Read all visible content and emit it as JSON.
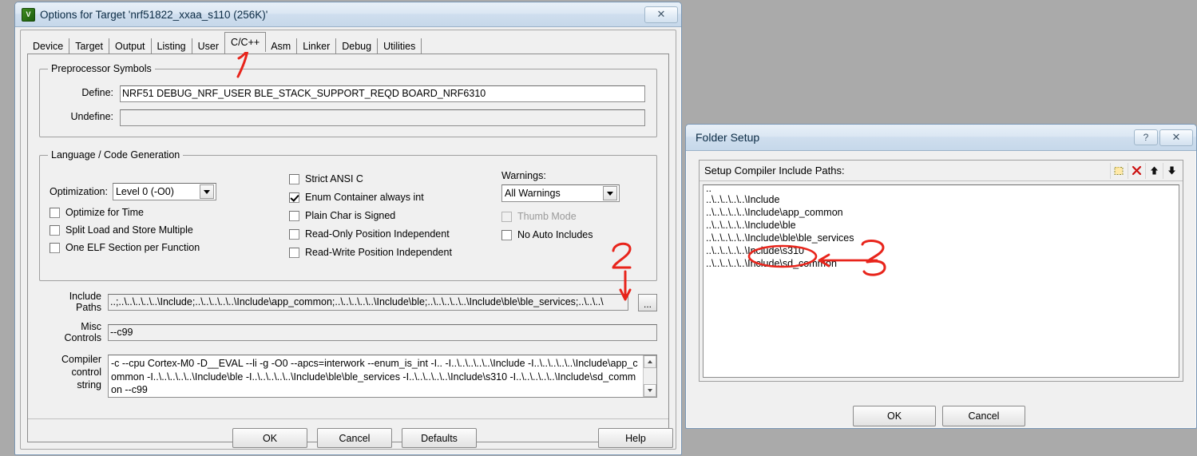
{
  "options_dialog": {
    "title": "Options for Target 'nrf51822_xxaa_s110 (256K)'",
    "icon": "keil-uvision-icon",
    "close_label": "✕",
    "tabs": [
      {
        "label": "Device",
        "active": false
      },
      {
        "label": "Target",
        "active": false
      },
      {
        "label": "Output",
        "active": false
      },
      {
        "label": "Listing",
        "active": false
      },
      {
        "label": "User",
        "active": false
      },
      {
        "label": "C/C++",
        "active": true
      },
      {
        "label": "Asm",
        "active": false
      },
      {
        "label": "Linker",
        "active": false
      },
      {
        "label": "Debug",
        "active": false
      },
      {
        "label": "Utilities",
        "active": false
      }
    ],
    "preprocessor": {
      "group_title": "Preprocessor Symbols",
      "define_label": "Define:",
      "define_value": "NRF51 DEBUG_NRF_USER BLE_STACK_SUPPORT_REQD BOARD_NRF6310",
      "undefine_label": "Undefine:",
      "undefine_value": ""
    },
    "language": {
      "group_title": "Language / Code Generation",
      "optimization_label": "Optimization:",
      "optimization_value": "Level 0 (-O0)",
      "warnings_label": "Warnings:",
      "warnings_value": "All Warnings",
      "left_options": [
        {
          "label": "Optimize for Time",
          "checked": false,
          "disabled": false
        },
        {
          "label": "Split Load and Store Multiple",
          "checked": false,
          "disabled": false
        },
        {
          "label": "One ELF Section per Function",
          "checked": false,
          "disabled": false
        }
      ],
      "middle_options": [
        {
          "label": "Strict ANSI C",
          "checked": false,
          "disabled": false
        },
        {
          "label": "Enum Container always int",
          "checked": true,
          "disabled": false
        },
        {
          "label": "Plain Char is Signed",
          "checked": false,
          "disabled": false
        },
        {
          "label": "Read-Only Position Independent",
          "checked": false,
          "disabled": false
        },
        {
          "label": "Read-Write Position Independent",
          "checked": false,
          "disabled": false
        }
      ],
      "right_options": [
        {
          "label": "Thumb Mode",
          "checked": false,
          "disabled": true
        },
        {
          "label": "No Auto Includes",
          "checked": false,
          "disabled": false
        }
      ]
    },
    "fields": {
      "include_paths_label_1": "Include",
      "include_paths_label_2": "Paths",
      "include_paths_value": "..;..\\..\\..\\..\\..\\Include;..\\..\\..\\..\\..\\Include\\app_common;..\\..\\..\\..\\..\\Include\\ble;..\\..\\..\\..\\..\\Include\\ble\\ble_services;..\\..\\..\\",
      "browse_label": "...",
      "misc_label_1": "Misc",
      "misc_label_2": "Controls",
      "misc_value": "--c99",
      "compiler_label_1": "Compiler",
      "compiler_label_2": "control",
      "compiler_label_3": "string",
      "compiler_value": "-c --cpu Cortex-M0 -D__EVAL --li -g -O0 --apcs=interwork --enum_is_int -I.. -I..\\..\\..\\..\\..\\Include -I..\\..\\..\\..\\..\\Include\\app_common -I..\\..\\..\\..\\..\\Include\\ble -I..\\..\\..\\..\\..\\Include\\ble\\ble_services -I..\\..\\..\\..\\..\\Include\\s310 -I..\\..\\..\\..\\..\\Include\\sd_common --c99"
    },
    "buttons": {
      "ok": "OK",
      "cancel": "Cancel",
      "defaults": "Defaults",
      "help": "Help"
    }
  },
  "folder_dialog": {
    "title": "Folder Setup",
    "help_label": "?",
    "close_label": "✕",
    "list_header": "Setup Compiler Include Paths:",
    "toolbar": [
      {
        "name": "new-folder-icon",
        "glyph": "▣"
      },
      {
        "name": "delete-icon",
        "glyph": "✕"
      },
      {
        "name": "move-up-icon",
        "glyph": "⬆"
      },
      {
        "name": "move-down-icon",
        "glyph": "⬇"
      }
    ],
    "paths": [
      "..",
      "..\\..\\..\\..\\..\\Include",
      "..\\..\\..\\..\\..\\Include\\app_common",
      "..\\..\\..\\..\\..\\Include\\ble",
      "..\\..\\..\\..\\..\\Include\\ble\\ble_services",
      "..\\..\\..\\..\\..\\Include\\s310",
      "..\\..\\..\\..\\..\\Include\\sd_common"
    ],
    "buttons": {
      "ok": "OK",
      "cancel": "Cancel"
    }
  },
  "annotations": {
    "color": "#e8241b",
    "marks": [
      {
        "label": "1",
        "target": "c-c++-tab"
      },
      {
        "label": "2",
        "target": "include-paths-browse-button"
      },
      {
        "label": "3",
        "target": "include-path-s310-row"
      }
    ]
  }
}
